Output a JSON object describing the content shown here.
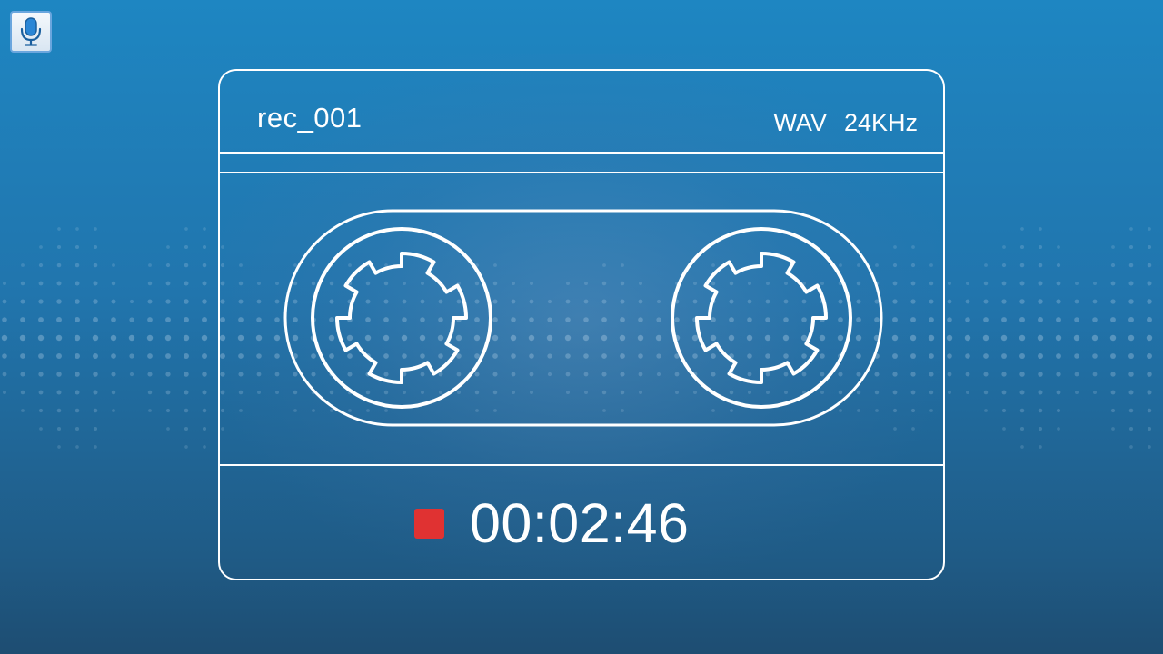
{
  "recording": {
    "file_name": "rec_001",
    "format": "WAV",
    "sample_rate": "24KHz",
    "elapsed_time": "00:02:46"
  },
  "icons": {
    "mic": "microphone-icon",
    "stop": "stop-icon",
    "reel": "tape-reel-icon"
  },
  "colors": {
    "background_top": "#1e86c2",
    "background_bottom": "#1e4d72",
    "outline": "#ffffff",
    "stop": "#e03232",
    "mic_button_border": "#6aa6de"
  }
}
